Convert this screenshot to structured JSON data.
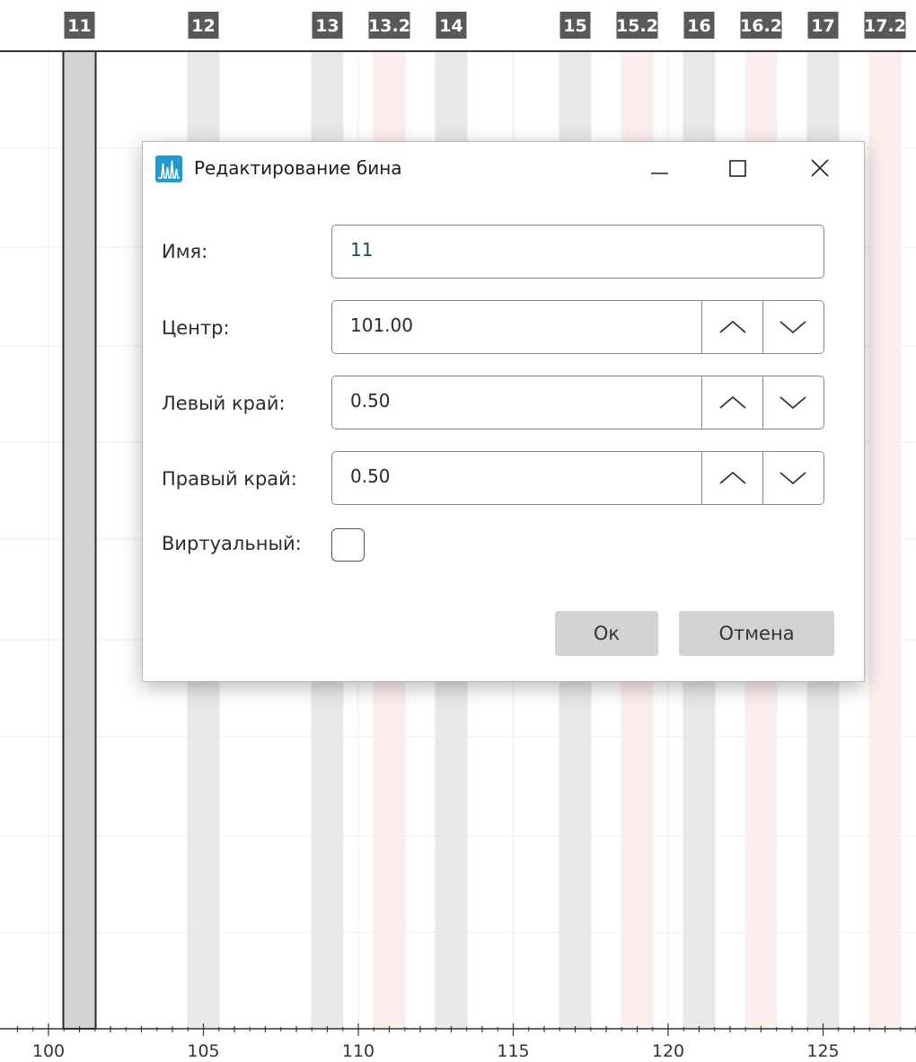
{
  "bins": [
    {
      "label": "11",
      "center": 101,
      "type": "selected"
    },
    {
      "label": "12",
      "center": 105,
      "type": "gray"
    },
    {
      "label": "13",
      "center": 109,
      "type": "gray"
    },
    {
      "label": "13.2",
      "center": 111,
      "type": "pink"
    },
    {
      "label": "14",
      "center": 113,
      "type": "gray"
    },
    {
      "label": "15",
      "center": 117,
      "type": "gray"
    },
    {
      "label": "15.2",
      "center": 119,
      "type": "pink"
    },
    {
      "label": "16",
      "center": 121,
      "type": "gray"
    },
    {
      "label": "16.2",
      "center": 123,
      "type": "pink"
    },
    {
      "label": "17",
      "center": 125,
      "type": "gray"
    },
    {
      "label": "17.2",
      "center": 127,
      "type": "pink"
    }
  ],
  "axis": {
    "x_min": 99,
    "x_max": 128,
    "major_ticks": [
      {
        "value": 100,
        "label": "100"
      },
      {
        "value": 105,
        "label": "105"
      },
      {
        "value": 110,
        "label": "110"
      },
      {
        "value": 115,
        "label": "115"
      },
      {
        "value": 120,
        "label": "120"
      },
      {
        "value": 125,
        "label": "125"
      }
    ]
  },
  "colors": {
    "label_bg": "#595959",
    "label_text": "#ffffff",
    "bin_gray": "#e8e8e8",
    "bin_pink": "#fdeeee",
    "bin_selected": "#d4d4d4",
    "grid": "#e6eef0",
    "axis": "#333333",
    "app_icon": "#1e9bd0"
  },
  "dialog": {
    "title": "Редактирование бина",
    "app_icon": "chromatogram-icon",
    "fields": {
      "name": {
        "label": "Имя:",
        "value": "11"
      },
      "center": {
        "label": "Центр:",
        "value": "101.00"
      },
      "left_edge": {
        "label": "Левый край:",
        "value": "0.50"
      },
      "right_edge": {
        "label": "Правый край:",
        "value": "0.50"
      },
      "virtual": {
        "label": "Виртуальный:",
        "checked": false
      }
    },
    "ok_label": "Ок",
    "cancel_label": "Отмена"
  }
}
